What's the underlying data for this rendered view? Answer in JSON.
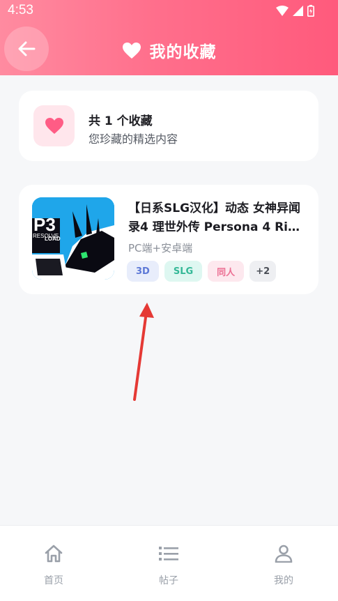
{
  "status_bar": {
    "time": "4:53"
  },
  "header": {
    "title": "我的收藏",
    "back_icon": "arrow-left-icon",
    "title_icon": "heart-icon"
  },
  "summary": {
    "count_text": "共 1 个收藏",
    "subtitle": "您珍藏的精选内容"
  },
  "favorites": [
    {
      "title": "【日系SLG汉化】动态 女神异闻录4 理世外传 Persona 4 Ri…",
      "platform": "PC端+安卓端",
      "tags": [
        "3D",
        "SLG",
        "同人",
        "+2"
      ],
      "thumbnail_text": [
        "P3",
        "RESOLVE",
        "LOAD"
      ]
    }
  ],
  "bottom_nav": {
    "items": [
      {
        "label": "首页",
        "icon": "home-icon"
      },
      {
        "label": "帖子",
        "icon": "list-icon"
      },
      {
        "label": "我的",
        "icon": "user-icon"
      }
    ]
  },
  "colors": {
    "header_start": "#ff8ba0",
    "header_end": "#ff5a7c",
    "accent_pink": "#ff5c85",
    "annotation_arrow": "#e53935"
  }
}
